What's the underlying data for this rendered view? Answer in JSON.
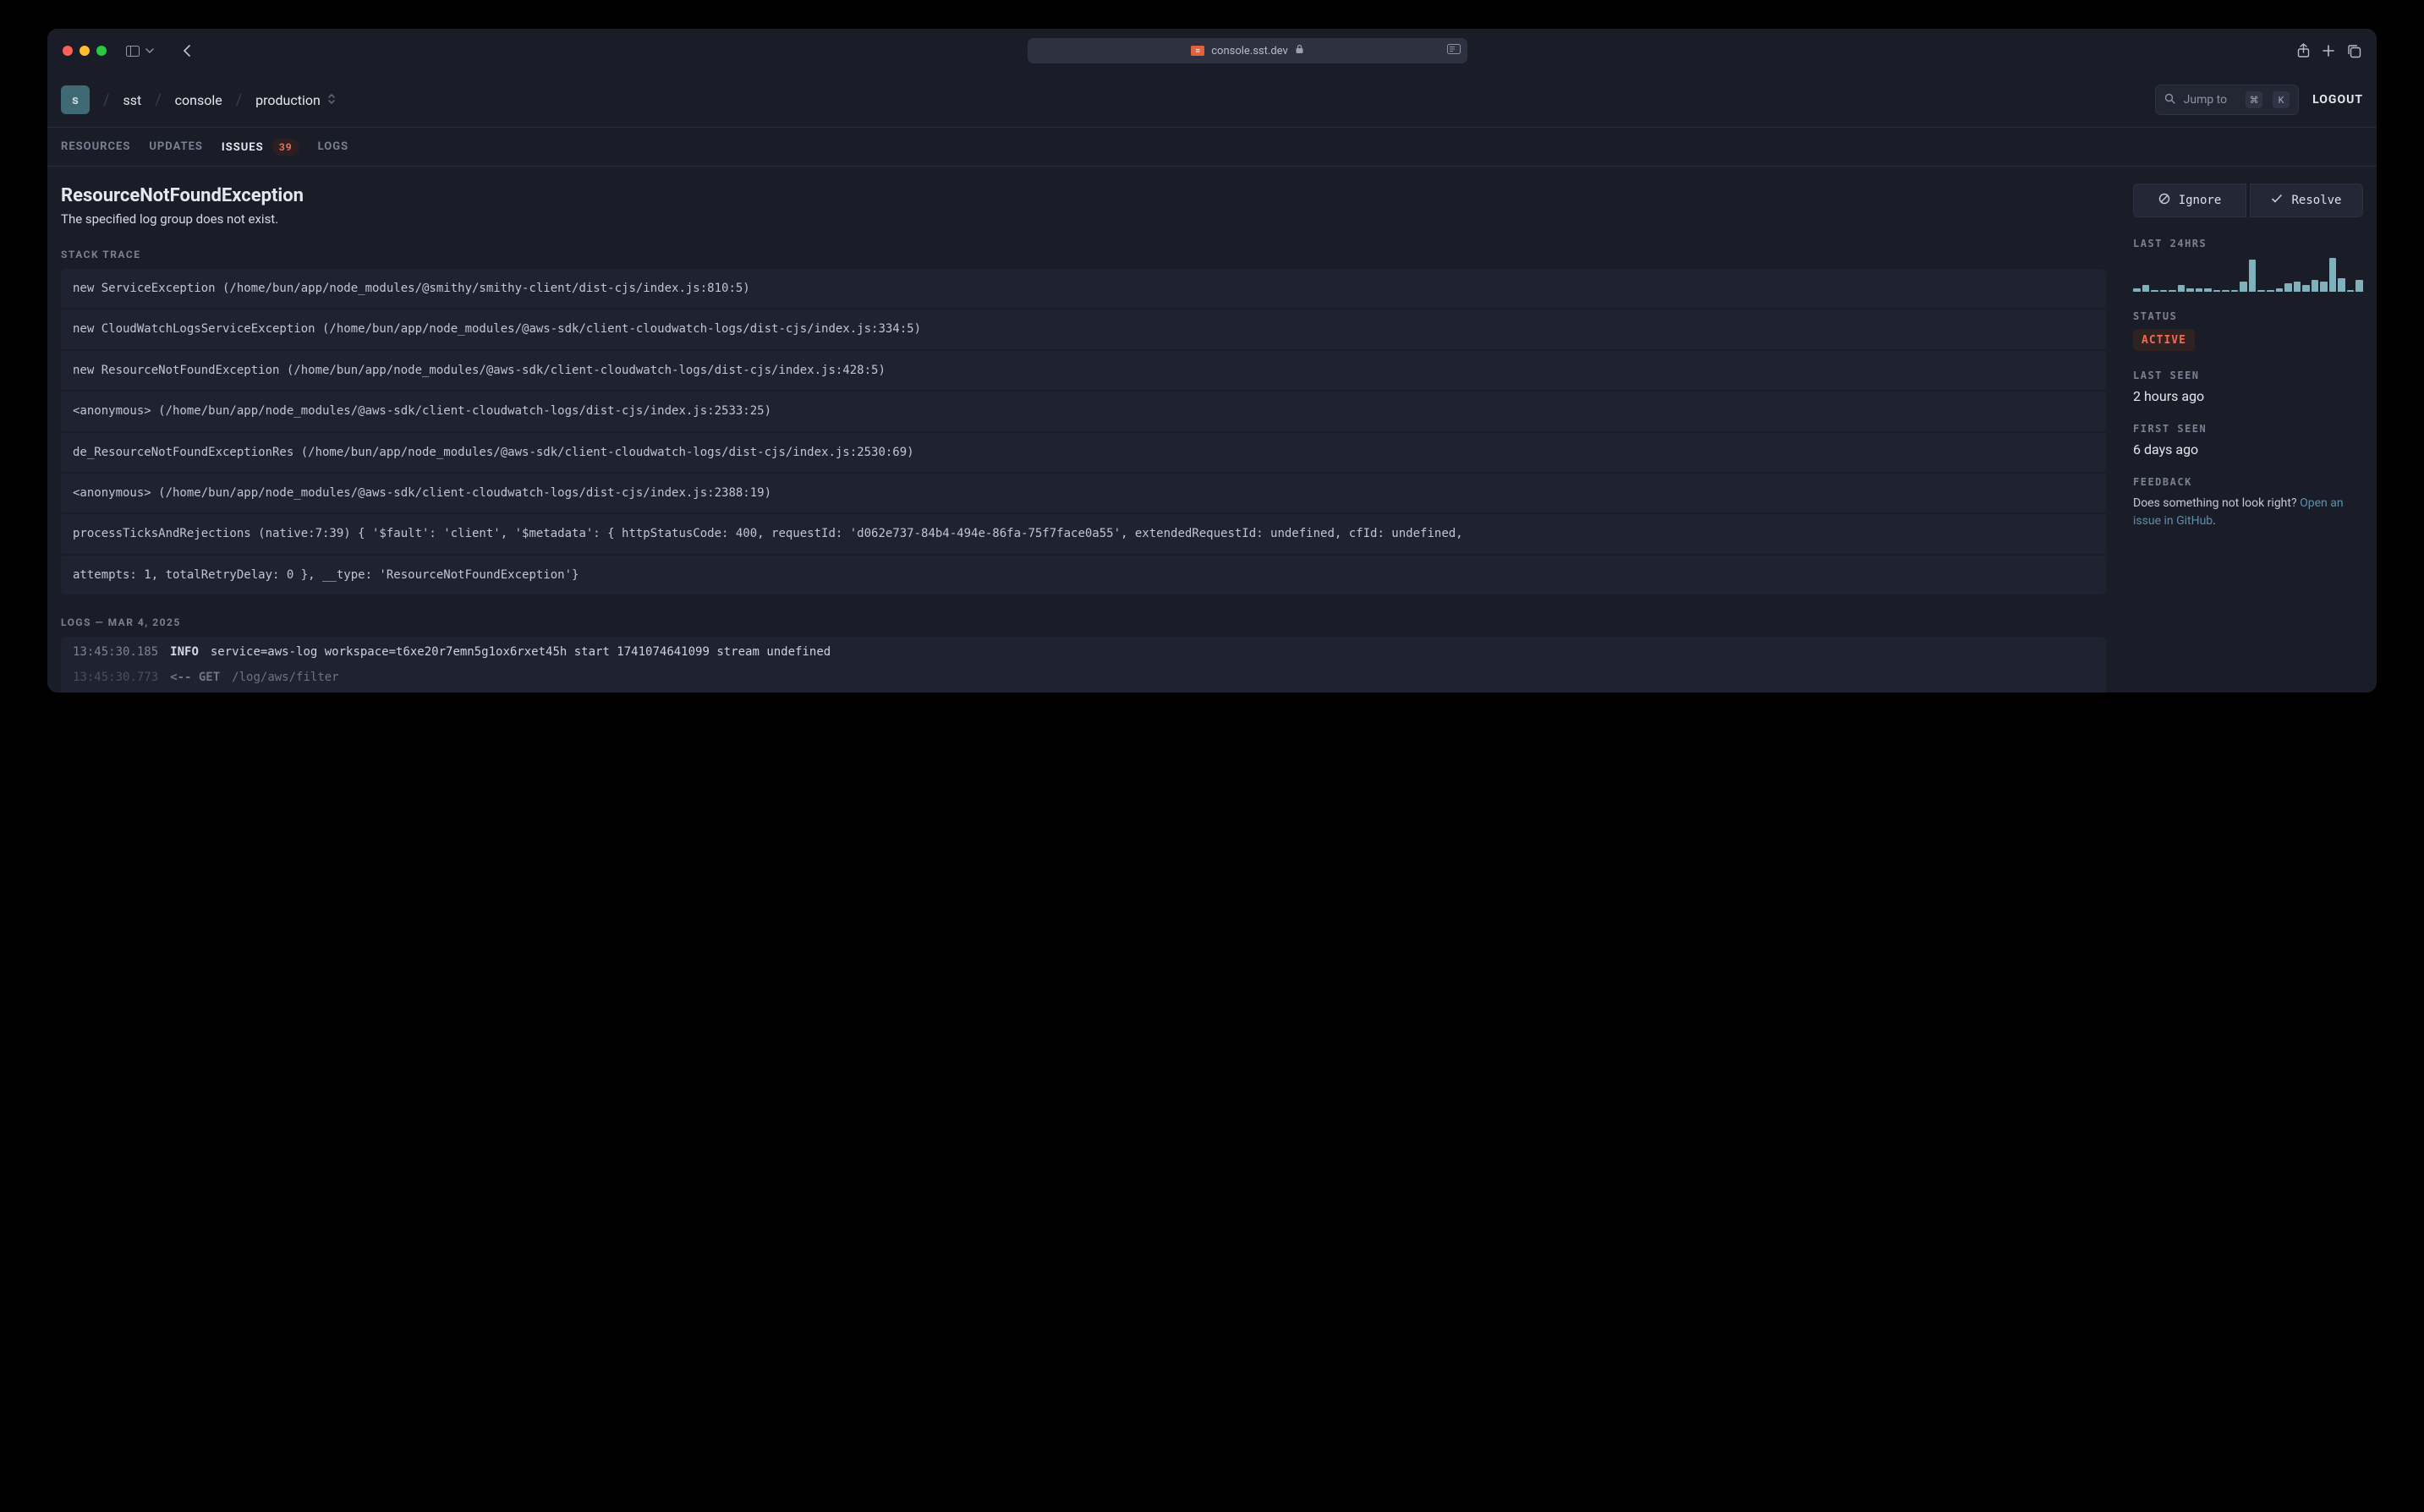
{
  "browser": {
    "url_host": "console.sst.dev"
  },
  "header": {
    "org_initial": "s",
    "crumbs": [
      "sst",
      "console",
      "production"
    ],
    "jump_label": "Jump to",
    "kbd1": "⌘",
    "kbd2": "K",
    "logout": "LOGOUT"
  },
  "tabs": {
    "resources": "RESOURCES",
    "updates": "UPDATES",
    "issues": "ISSUES",
    "issues_count": "39",
    "logs": "LOGS"
  },
  "issue": {
    "title": "ResourceNotFoundException",
    "subtitle": "The specified log group does not exist.",
    "stack_label": "STACK TRACE",
    "stack": [
      "new ServiceException (/home/bun/app/node_modules/@smithy/smithy-client/dist-cjs/index.js:810:5)",
      "new CloudWatchLogsServiceException (/home/bun/app/node_modules/@aws-sdk/client-cloudwatch-logs/dist-cjs/index.js:334:5)",
      "new ResourceNotFoundException (/home/bun/app/node_modules/@aws-sdk/client-cloudwatch-logs/dist-cjs/index.js:428:5)",
      "<anonymous> (/home/bun/app/node_modules/@aws-sdk/client-cloudwatch-logs/dist-cjs/index.js:2533:25)",
      "de_ResourceNotFoundExceptionRes (/home/bun/app/node_modules/@aws-sdk/client-cloudwatch-logs/dist-cjs/index.js:2530:69)",
      "<anonymous> (/home/bun/app/node_modules/@aws-sdk/client-cloudwatch-logs/dist-cjs/index.js:2388:19)",
      "processTicksAndRejections (native:7:39) { '$fault': 'client', '$metadata': { httpStatusCode: 400, requestId: 'd062e737-84b4-494e-86fa-75f7face0a55', extendedRequestId: undefined, cfId: undefined,",
      "attempts: 1, totalRetryDelay: 0 }, __type: 'ResourceNotFoundException'}"
    ],
    "logs_label": "LOGS — MAR 4, 2025",
    "logs": [
      {
        "ts": "13:45:30.185",
        "level": "INFO",
        "msg": "service=aws-log workspace=t6xe20r7emn5g1ox6rxet45h start 1741074641099 stream undefined"
      },
      {
        "ts": "13:45:30.773",
        "level": "<-- GET",
        "msg": "/log/aws/filter"
      }
    ]
  },
  "side": {
    "ignore": "Ignore",
    "resolve": "Resolve",
    "last24_label": "LAST 24HRS",
    "status_label": "STATUS",
    "status_value": "ACTIVE",
    "last_seen_label": "LAST SEEN",
    "last_seen_value": "2 hours ago",
    "first_seen_label": "FIRST SEEN",
    "first_seen_value": "6 days ago",
    "feedback_label": "FEEDBACK",
    "feedback_text": "Does something not look right? ",
    "feedback_link": "Open an issue in GitHub",
    "feedback_period": "."
  },
  "chart_data": {
    "type": "bar",
    "title": "LAST 24HRS",
    "categories_count": 24,
    "values": [
      4,
      8,
      2,
      2,
      2,
      8,
      4,
      4,
      4,
      2,
      2,
      2,
      12,
      38,
      2,
      2,
      4,
      10,
      12,
      8,
      14,
      12,
      40,
      16,
      2,
      14
    ],
    "ylim": [
      0,
      40
    ]
  }
}
